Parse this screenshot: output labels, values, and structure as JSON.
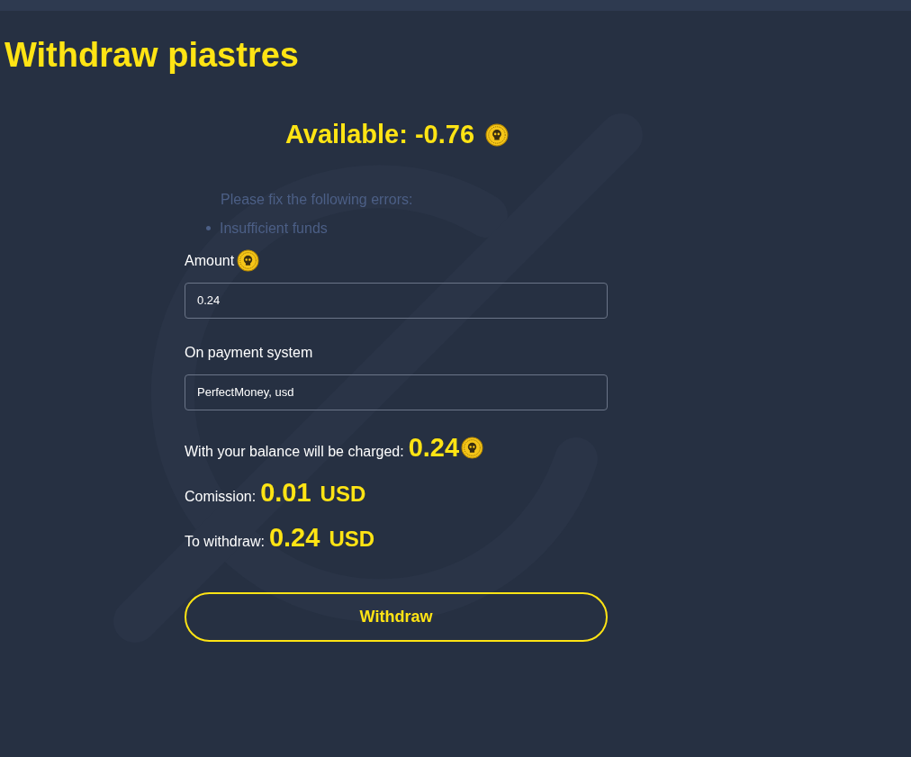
{
  "title": "Withdraw piastres",
  "available": {
    "label": "Available:",
    "value": "-0.76"
  },
  "errors": {
    "heading": "Please fix the following errors:",
    "items": [
      "Insufficient funds"
    ]
  },
  "fields": [
    {
      "label": "Amount",
      "coin": true,
      "value": "0.24"
    },
    {
      "label": "On payment system",
      "coin": false,
      "value": "PerfectMoney, usd"
    }
  ],
  "summary": [
    {
      "label": "With your balance will be charged:",
      "value": "0.24",
      "kind": "coin"
    },
    {
      "label": "Comission:",
      "value": "0.01",
      "kind": "currency",
      "unit": "USD"
    },
    {
      "label": "To withdraw:",
      "value": "0.24",
      "kind": "currency",
      "unit": "USD"
    }
  ],
  "button": "Withdraw"
}
